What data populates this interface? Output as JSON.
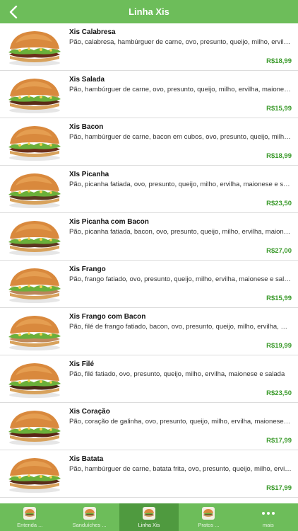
{
  "header": {
    "title": "Linha Xis",
    "back_icon": "chevron-left-icon"
  },
  "products": [
    {
      "name": "Xis Calabresa",
      "description": "Pão, calabresa, hambúrguer de carne, ovo, presunto, queijo, milho, ervilha, maionese e salada",
      "price": "R$18,99"
    },
    {
      "name": "Xis Salada",
      "description": "Pão, hambúrguer de carne, ovo, presunto, queijo, milho, ervilha, maionese e salada",
      "price": "R$15,99"
    },
    {
      "name": "Xis Bacon",
      "description": "Pão, hambúrguer de carne, bacon em cubos, ovo, presunto, queijo, milho, ervilha, maionese e salada",
      "price": "R$18,99"
    },
    {
      "name": "XIs Picanha",
      "description": "Pão, picanha fatiada, ovo, presunto, queijo, milho, ervilha, maionese e salada",
      "price": "R$23,50"
    },
    {
      "name": "Xis Picanha com Bacon",
      "description": "Pão, picanha fatiada, bacon, ovo, presunto, queijo, milho, ervilha, maionese e salada",
      "price": "R$27,00"
    },
    {
      "name": "Xis Frango",
      "description": "Pão, frango fatiado, ovo, presunto, queijo, milho, ervilha, maionese e salada",
      "price": "R$15,99"
    },
    {
      "name": "Xis Frango com Bacon",
      "description": "Pão, filé de frango fatiado, bacon, ovo, presunto, queijo, milho, ervilha, maionese e salada",
      "price": "R$19,99"
    },
    {
      "name": "Xis Filé",
      "description": "Pão, filé fatiado, ovo, presunto, queijo, milho, ervilha, maionese e salada",
      "price": "R$23,50"
    },
    {
      "name": "Xis Coração",
      "description": "Pão, coração de galinha, ovo, presunto, queijo, milho, ervilha, maionese e salada",
      "price": "R$17,99"
    },
    {
      "name": "Xis Batata",
      "description": "Pão, hambúrguer de carne, batata frita, ovo, presunto, queijo, milho, ervilha, maionese e salada",
      "price": "R$17,99"
    }
  ],
  "tabs": [
    {
      "label": "Entenda ...",
      "icon": "food-thumbnail-icon",
      "active": false
    },
    {
      "label": "Sanduíches ...",
      "icon": "sandwich-icon",
      "active": false
    },
    {
      "label": "Linha Xis",
      "icon": "burger-icon",
      "active": true
    },
    {
      "label": "Pratos ...",
      "icon": "plate-icon",
      "active": false
    },
    {
      "label": "mais",
      "icon": "more-dots-icon",
      "active": false
    }
  ],
  "colors": {
    "brand_green": "#6dbd5a",
    "active_tab_green": "#4f9a3f",
    "price_green": "#3a9a2a"
  }
}
